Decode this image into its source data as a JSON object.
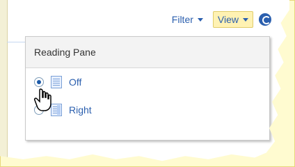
{
  "toolbar": {
    "filter_label": "Filter",
    "view_label": "View"
  },
  "menu": {
    "title": "Reading Pane",
    "items": [
      {
        "label": "Off",
        "checked": true
      },
      {
        "label": "Right",
        "checked": false
      }
    ]
  },
  "colors": {
    "link_blue": "#2b5fae",
    "highlight_yellow": "#fff2b3"
  },
  "icons": {
    "refresh": "refresh-icon",
    "pane_off": "pane-off-icon",
    "pane_right": "pane-right-icon",
    "cursor": "hand-cursor-icon"
  }
}
